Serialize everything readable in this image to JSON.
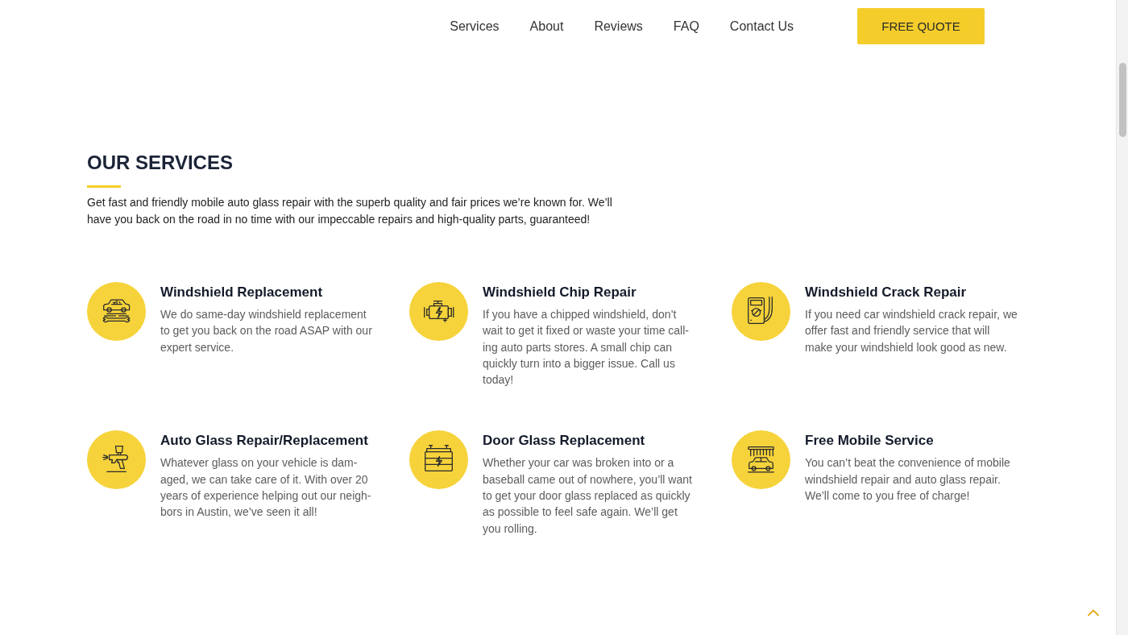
{
  "header": {
    "nav_links": [
      "Services",
      "About",
      "Reviews",
      "FAQ",
      "Contact Us"
    ],
    "quote_button": "FREE QUOTE"
  },
  "services_section": {
    "heading": "OUR SERVICES",
    "intro": "Get fast and friendly mobile auto glass repair with the superb quality and fair prices we’re known for. We’ll have you back on the road in no time with our impeccable repairs and high-quality parts, guaranteed!",
    "services": [
      {
        "title": "Windshield Replacement",
        "description": "We do same-day windshield replacement to get you back on the road ASAP with our expert service."
      },
      {
        "title": "Windshield Chip Repair",
        "description": "If you have a chipped windshield, don’t wait to get it fixed or waste your time call-ing auto parts stores. A small chip can quickly turn into a bigger issue. Call us today!"
      },
      {
        "title": "Windshield Crack Repair",
        "description": "If you need car windshield crack repair, we offer fast and friendly service that will make your windshield look good as new."
      },
      {
        "title": "Auto Glass Repair/Replacement",
        "description": "Whatever glass on your vehicle is dam-aged, we can take care of it. With over 20 years of experience helping out our neigh-bors in Austin, we’ve seen it all!"
      },
      {
        "title": "Door Glass Replacement",
        "description": "Whether your car was broken into or a baseball came out of nowhere, you’ll want to get your door glass replaced as quickly as possible to feel safe again. We’ll get you rolling."
      },
      {
        "title": "Free Mobile Service",
        "description": "You can’t beat the convenience of mobile windshield repair and auto glass repair. We’ll come to you free of charge!"
      }
    ]
  }
}
